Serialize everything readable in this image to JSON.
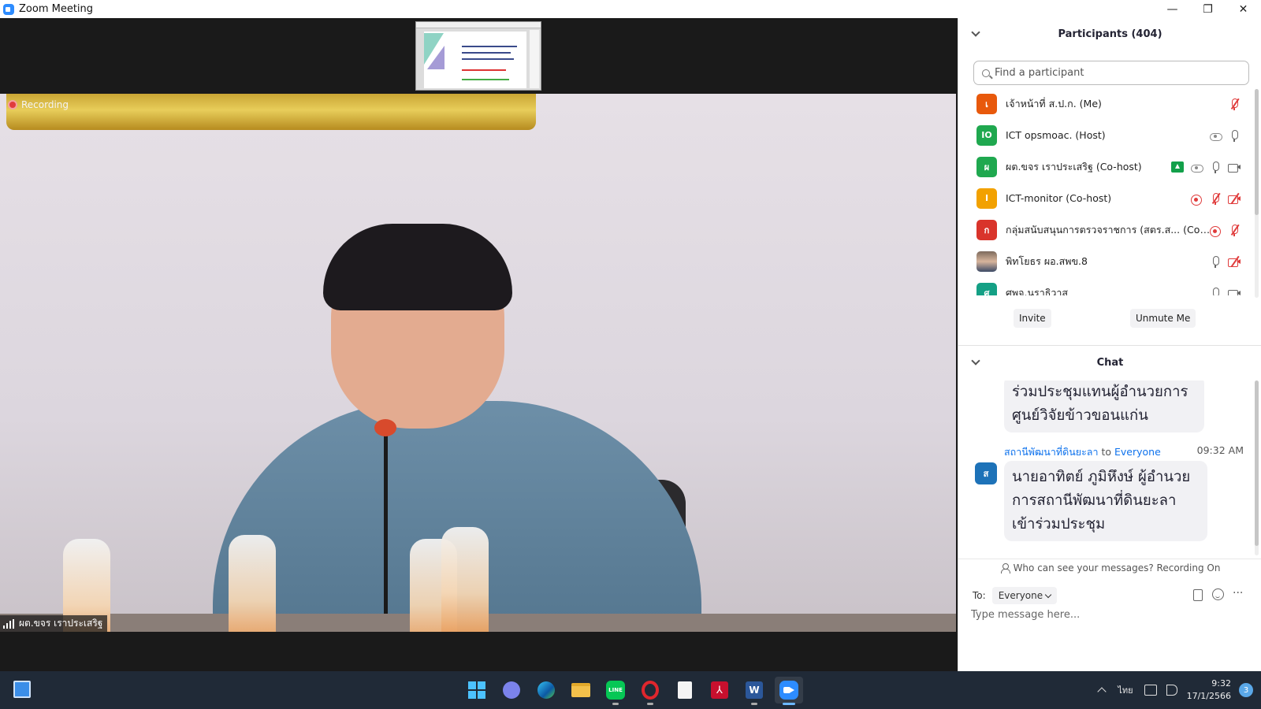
{
  "window": {
    "title": "Zoom Meeting",
    "controls": {
      "minimize": "—",
      "restore": "❐",
      "close": "✕"
    }
  },
  "video": {
    "recording_label": "Recording",
    "active_speaker_name": "ผต.ขจร  เราประเสริฐ"
  },
  "participants": {
    "header": "Participants (404)",
    "search_placeholder": "Find a participant",
    "items": [
      {
        "avatar": "เ",
        "name": "เจ้าหน้าที่ ส.ป.ก. (Me)",
        "color": "#e8590c",
        "icons": [
          "mic-muted"
        ]
      },
      {
        "avatar": "IO",
        "name": "ICT opsmoac. (Host)",
        "color": "#1fa84f",
        "icons": [
          "cloud",
          "mic"
        ]
      },
      {
        "avatar": "ผ",
        "name": "ผต.ขจร  เราประเสริฐ (Co-host)",
        "color": "#1fa84f",
        "icons": [
          "share",
          "cloud",
          "mic",
          "cam"
        ]
      },
      {
        "avatar": "I",
        "name": "ICT-monitor (Co-host)",
        "color": "#f2a100",
        "icons": [
          "rec",
          "mic-muted",
          "cam-off"
        ]
      },
      {
        "avatar": "ก",
        "name": "กลุ่มสนับสนุนการตรวจราชการ (สตร.ส... (Co-host)",
        "color": "#d9342b",
        "icons": [
          "rec",
          "mic-muted"
        ]
      },
      {
        "avatar": "",
        "name": "พิทโยธร ผอ.สพข.8",
        "color": "photo",
        "icons": [
          "mic",
          "cam-off"
        ]
      },
      {
        "avatar": "ศ",
        "name": "ศพจ.นราธิวาส",
        "color": "#14a085",
        "icons": [
          "mic",
          "cam"
        ]
      }
    ],
    "invite_label": "Invite",
    "unmute_label": "Unmute Me"
  },
  "chat": {
    "header": "Chat",
    "messages": [
      {
        "text": "ร่วมประชุมแทนผู้อำนวยการศูนย์วิจัยข้าวขอนแก่น"
      },
      {
        "sender": "สถานีพัฒนาที่ดินยะลา",
        "to_word": "to",
        "recipient": "Everyone",
        "time": "09:32 AM",
        "avatar": "ส",
        "text": "นายอาทิตย์ ภูมิหึงษ์ ผู้อำนวยการสถานีพัฒนาที่ดินยะลา เข้าร่วมประชุม"
      }
    ],
    "notice": "Who can see your messages? Recording On",
    "to_label": "To:",
    "to_value": "Everyone",
    "input_placeholder": "Type message here...",
    "more_glyph": "···"
  },
  "taskbar": {
    "apps": [
      "windows-start",
      "teams-chat",
      "edge",
      "file-explorer",
      "line",
      "opera",
      "notepad",
      "acrobat",
      "word",
      "zoom"
    ],
    "line_label": "LINE",
    "word_label": "W",
    "pdf_label": "⅄",
    "language": "ไทย",
    "time": "9:32",
    "date": "17/1/2566",
    "notification_count": "3"
  }
}
